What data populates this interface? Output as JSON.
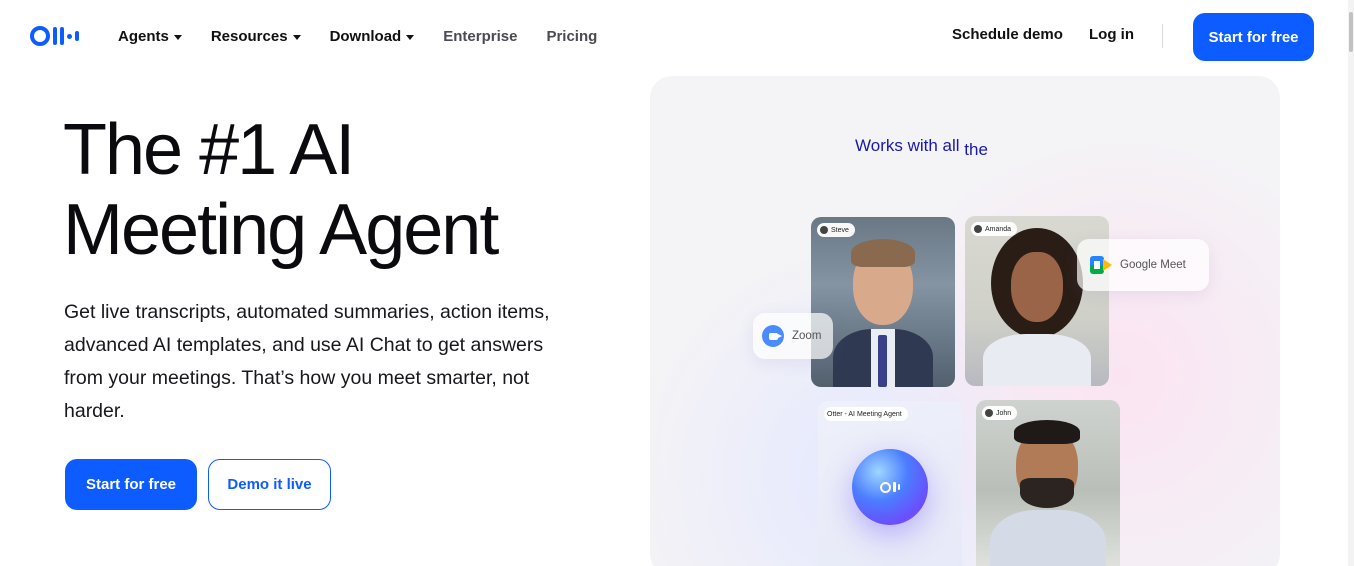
{
  "nav": {
    "logo_alt": "Otter",
    "items": [
      {
        "label": "Agents",
        "dropdown": true
      },
      {
        "label": "Resources",
        "dropdown": true
      },
      {
        "label": "Download",
        "dropdown": true
      },
      {
        "label": "Enterprise",
        "dropdown": false
      },
      {
        "label": "Pricing",
        "dropdown": false
      }
    ],
    "schedule_demo": "Schedule demo",
    "login": "Log in",
    "cta": "Start for free"
  },
  "hero": {
    "title_line1": "The #1 AI",
    "title_line2": "Meeting Agent",
    "subtitle": "Get live transcripts, automated summaries, action items, advanced AI templates, and use AI Chat to get answers from your meetings. That’s how you meet smarter, not harder.",
    "primary_cta": "Start for free",
    "secondary_cta": "Demo it live"
  },
  "visual": {
    "works_with": "Works with all",
    "works_with_tail": "the",
    "participants": {
      "steve": "Steve",
      "amanda": "Amanda",
      "otter": "Otter - AI Meeting Agent",
      "john": "John"
    },
    "integrations": {
      "zoom": "Zoom",
      "google_meet": "Google Meet"
    }
  },
  "colors": {
    "brand_blue": "#0d5cff",
    "heading": "#0b0b0f",
    "works_with_text": "#1a1aa8"
  }
}
